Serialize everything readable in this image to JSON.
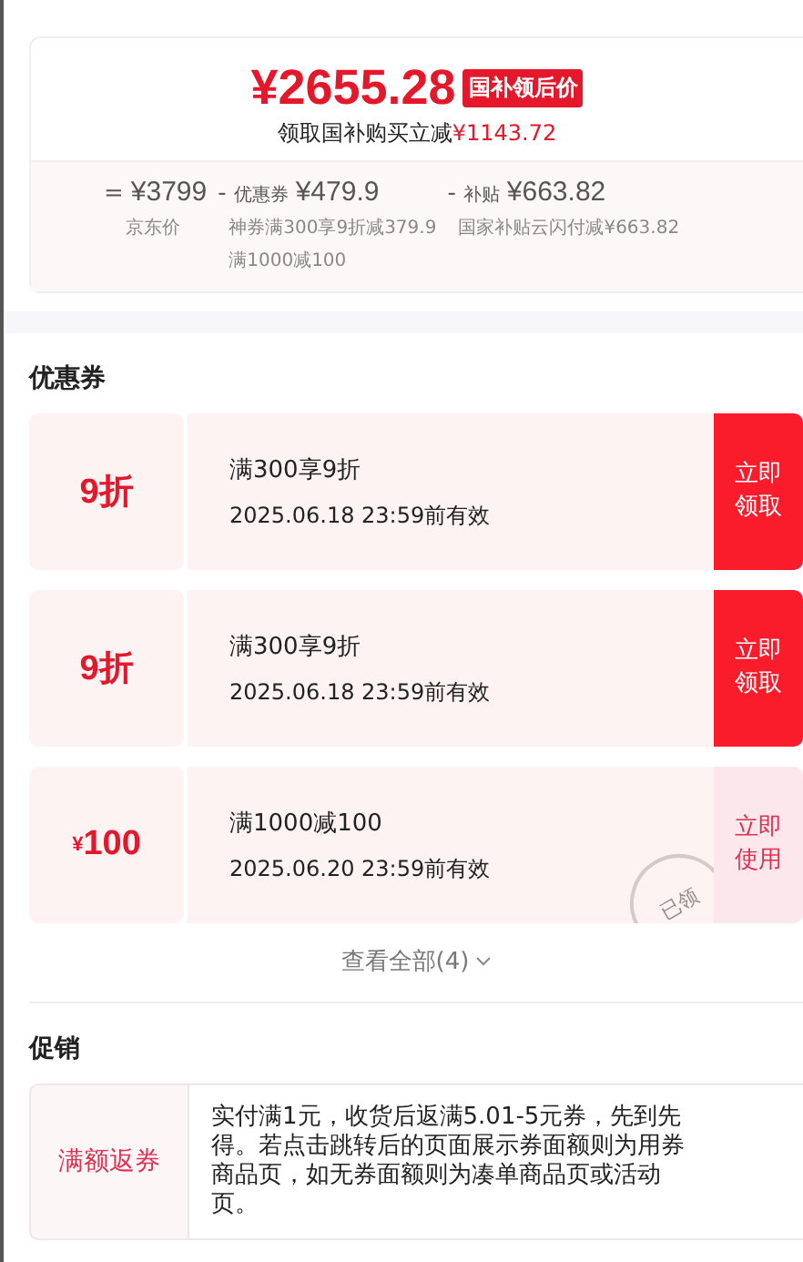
{
  "price_card": {
    "price": "¥2655.28",
    "price_tag": "国补领后价",
    "subtitle_prefix": "领取国补购买立减",
    "subtitle_amount": "¥1143.72",
    "breakdown": [
      {
        "sign": "=",
        "amount": "¥3799",
        "notes": [
          "京东价"
        ]
      },
      {
        "sign": "-",
        "label": "优惠券",
        "amount": "¥479.9",
        "notes": [
          "神券满300享9折减379.9",
          "满1000减100"
        ]
      },
      {
        "sign": "-",
        "label": "补贴",
        "amount": "¥663.82",
        "notes": [
          "国家补贴云闪付减¥663.82"
        ]
      }
    ]
  },
  "coupons": {
    "title": "优惠券",
    "items": [
      {
        "value": "9折",
        "name": "满300享9折",
        "expiry": "2025.06.18 23:59前有效",
        "action": "立即领取",
        "claimed": false
      },
      {
        "value": "9折",
        "name": "满300享9折",
        "expiry": "2025.06.18 23:59前有效",
        "action": "立即领取",
        "claimed": false
      },
      {
        "currency": "¥",
        "value": "100",
        "name": "满1000减100",
        "expiry": "2025.06.20 23:59前有效",
        "action": "立即使用",
        "claimed": true,
        "stamp": "已领"
      }
    ],
    "view_all": "查看全部(4)"
  },
  "promotions": {
    "title": "促销",
    "items": [
      {
        "tag": "满额返券",
        "description": "实付满1元，收货后返满5.01-5元券，先到先得。若点击跳转后的页面展示券面额则为用券商品页，如无券面额则为凑单商品页或活动页。"
      }
    ]
  }
}
